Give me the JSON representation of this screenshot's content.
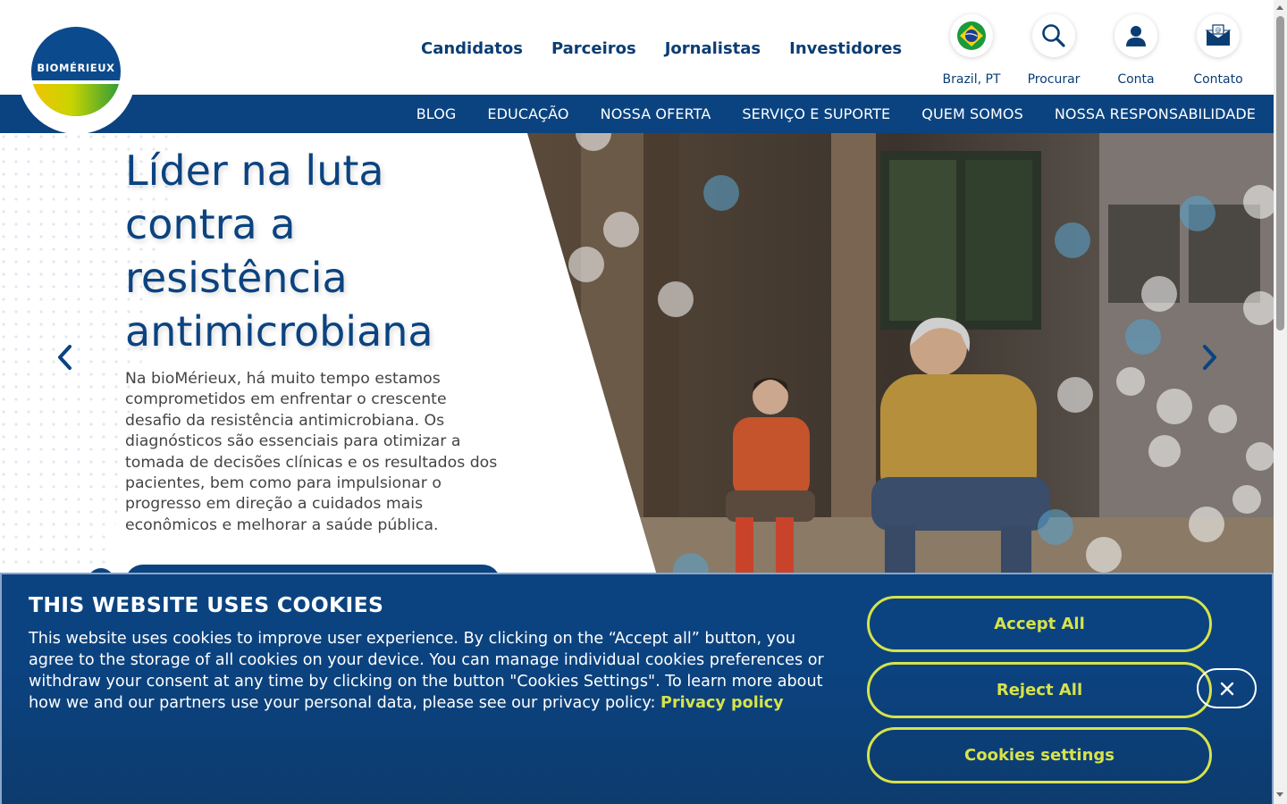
{
  "brand": {
    "logo_text": "BIOMÉRIEUX"
  },
  "primary_nav": [
    "Candidatos",
    "Parceiros",
    "Jornalistas",
    "Investidores"
  ],
  "utilities": {
    "region": "Brazil, PT",
    "search": "Procurar",
    "account": "Conta",
    "contact": "Contato"
  },
  "secondary_nav": [
    "BLOG",
    "EDUCAÇÃO",
    "NOSSA OFERTA",
    "SERVIÇO E SUPORTE",
    "QUEM SOMOS",
    "NOSSA RESPONSABILIDADE"
  ],
  "hero": {
    "title": "Líder na luta contra a resistência antimicrobiana",
    "body": "Na bioMérieux, há muito tempo estamos comprometidos em enfrentar o crescente desafio da resistência antimicrobiana. Os diagnósticos são essenciais para otimizar a tomada de decisões clínicas e os resultados dos pacientes, bem como para impulsionar o progresso em direção a cuidados mais econômicos e melhorar a saúde pública."
  },
  "cookie_banner": {
    "title": "THIS WEBSITE USES COOKIES",
    "text": "This website uses cookies to improve user experience. By clicking on the “Accept all” button, you agree to the storage of all cookies on your device. You can manage individual cookies preferences or withdraw your consent at any time by clicking on the button \"Cookies Settings\". To learn more about how we and our partners use your personal data, please see our privacy policy: ",
    "privacy_link": "Privacy policy",
    "accept_label": "Accept All",
    "reject_label": "Reject All",
    "settings_label": "Cookies settings"
  },
  "colors": {
    "brand_blue": "#0b4380",
    "nav_text": "#0b3d73",
    "accent_yellow": "#d7e34a"
  },
  "icons": [
    "flag-brazil-icon",
    "search-icon",
    "user-icon",
    "mail-icon",
    "chevron-left-icon",
    "chevron-right-icon",
    "close-icon"
  ]
}
